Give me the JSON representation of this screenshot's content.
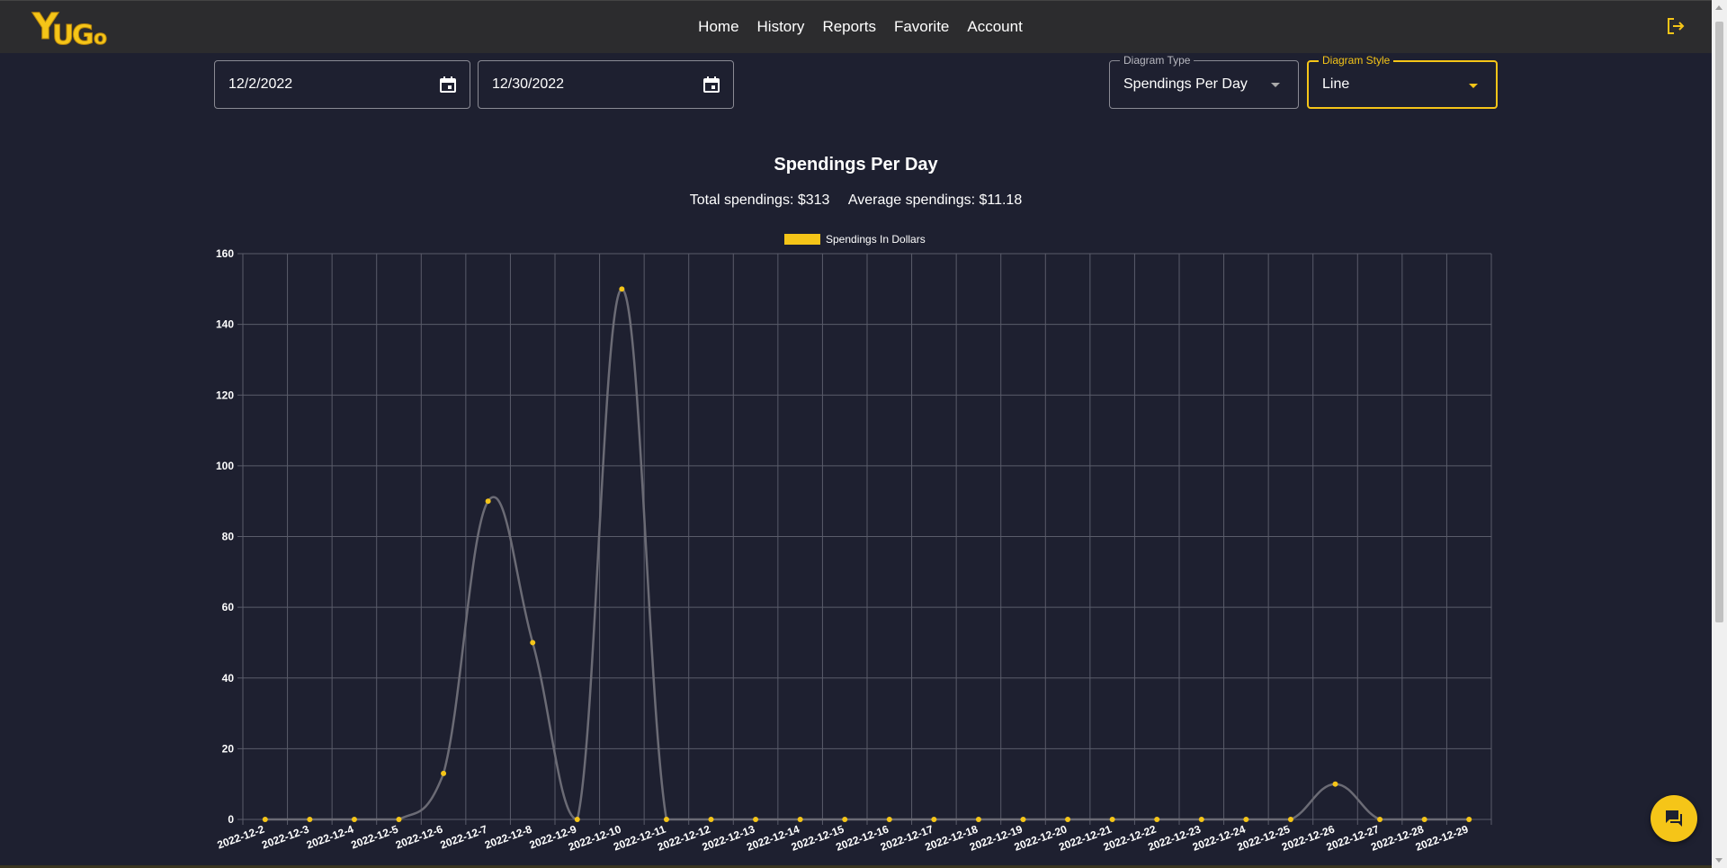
{
  "brand": {
    "logo_text": "YUGo",
    "accent_color": "#f5c518"
  },
  "nav": {
    "items": [
      "Home",
      "History",
      "Reports",
      "Favorite",
      "Account"
    ]
  },
  "filters": {
    "start_date": "12/2/2022",
    "end_date": "12/30/2022",
    "diagram_type_label": "Diagram Type",
    "diagram_type_value": "Spendings Per Day",
    "diagram_style_label": "Diagram Style",
    "diagram_style_value": "Line"
  },
  "report": {
    "title": "Spendings Per Day",
    "total": "Total spendings: $313",
    "average": "Average spendings: $11.18"
  },
  "icons": {
    "calendar": "calendar-icon",
    "logout": "logout-icon",
    "chat": "chat-icon"
  },
  "chart_data": {
    "type": "line",
    "legend": "top",
    "grid": true,
    "ylim": [
      0,
      160
    ],
    "yticks": [
      0,
      20,
      40,
      60,
      80,
      100,
      120,
      140,
      160
    ],
    "categories": [
      "2022-12-2",
      "2022-12-3",
      "2022-12-4",
      "2022-12-5",
      "2022-12-6",
      "2022-12-7",
      "2022-12-8",
      "2022-12-9",
      "2022-12-10",
      "2022-12-11",
      "2022-12-12",
      "2022-12-13",
      "2022-12-14",
      "2022-12-15",
      "2022-12-16",
      "2022-12-17",
      "2022-12-18",
      "2022-12-19",
      "2022-12-20",
      "2022-12-21",
      "2022-12-22",
      "2022-12-23",
      "2022-12-24",
      "2022-12-25",
      "2022-12-26",
      "2022-12-27",
      "2022-12-28",
      "2022-12-29"
    ],
    "series": [
      {
        "name": "Spendings In Dollars",
        "color": "#f5c518",
        "line_color": "#6b6b75",
        "values": [
          0,
          0,
          0,
          0,
          13,
          90,
          50,
          0,
          150,
          0,
          0,
          0,
          0,
          0,
          0,
          0,
          0,
          0,
          0,
          0,
          0,
          0,
          0,
          0,
          10,
          0,
          0,
          0
        ]
      }
    ]
  }
}
